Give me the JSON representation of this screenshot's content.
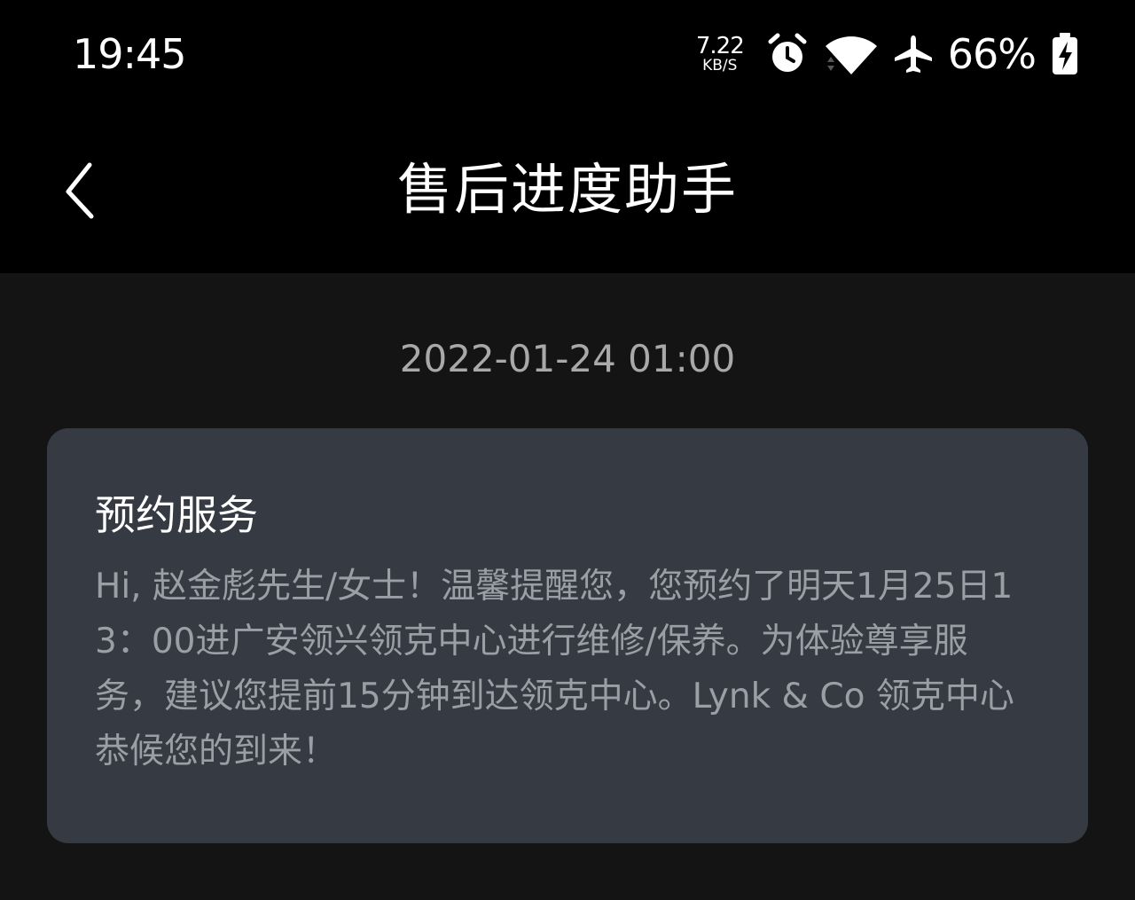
{
  "status_bar": {
    "time": "19:45",
    "net_speed_value": "7.22",
    "net_speed_unit": "KB/S",
    "icons": [
      "alarm-icon",
      "wifi-icon",
      "airplane-mode-icon",
      "battery-charging-icon"
    ],
    "battery_percent": "66%",
    "battery_level": 0.66
  },
  "nav": {
    "back_icon": "chevron-left-icon",
    "title": "售后进度助手"
  },
  "message": {
    "timestamp": "2022-01-24 01:00",
    "card_title": "预约服务",
    "card_body": "Hi, 赵金彪先生/女士！温馨提醒您，您预约了明天1月25日13：00进广安领兴领克中心进行维修/保养。为体验尊享服务，建议您提前15分钟到达领克中心。Lynk & Co 领克中心恭候您的到来！"
  },
  "colors": {
    "background": "#141414",
    "bar_background": "#000000",
    "card_background": "#363a42",
    "title_text": "#ffffff",
    "body_text": "#9a9ea5",
    "timestamp_text": "#a9a9a9"
  }
}
